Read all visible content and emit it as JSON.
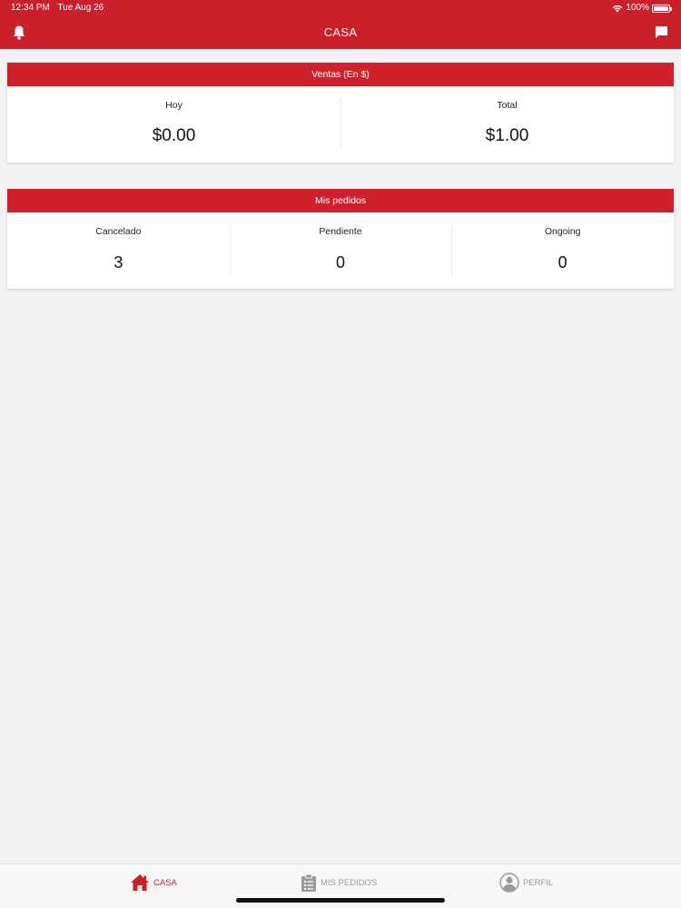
{
  "status_bar": {
    "time": "12:34 PM",
    "date": "Tue Aug 26",
    "battery": "100%"
  },
  "header": {
    "title": "CASA",
    "left_icon": "bell-icon",
    "right_icon": "chat-icon"
  },
  "sales_card": {
    "title": "Ventas (En $)",
    "stats": [
      {
        "label": "Hoy",
        "value": "$0.00"
      },
      {
        "label": "Total",
        "value": "$1.00"
      }
    ]
  },
  "orders_card": {
    "title": "Mis pedidos",
    "stats": [
      {
        "label": "Cancelado",
        "value": "3"
      },
      {
        "label": "Pendiente",
        "value": "0"
      },
      {
        "label": "Ongoing",
        "value": "0"
      }
    ]
  },
  "tabbar": {
    "tabs": [
      {
        "label": "CASA",
        "icon": "home-icon",
        "active": true
      },
      {
        "label": "MIS PEDIDOS",
        "icon": "clipboard-icon",
        "active": false
      },
      {
        "label": "PERFIL",
        "icon": "user-icon",
        "active": false
      }
    ]
  },
  "colors": {
    "brand_red": "#c9202a",
    "inactive_gray": "#9a9a9a",
    "background": "#f2f2f4"
  }
}
